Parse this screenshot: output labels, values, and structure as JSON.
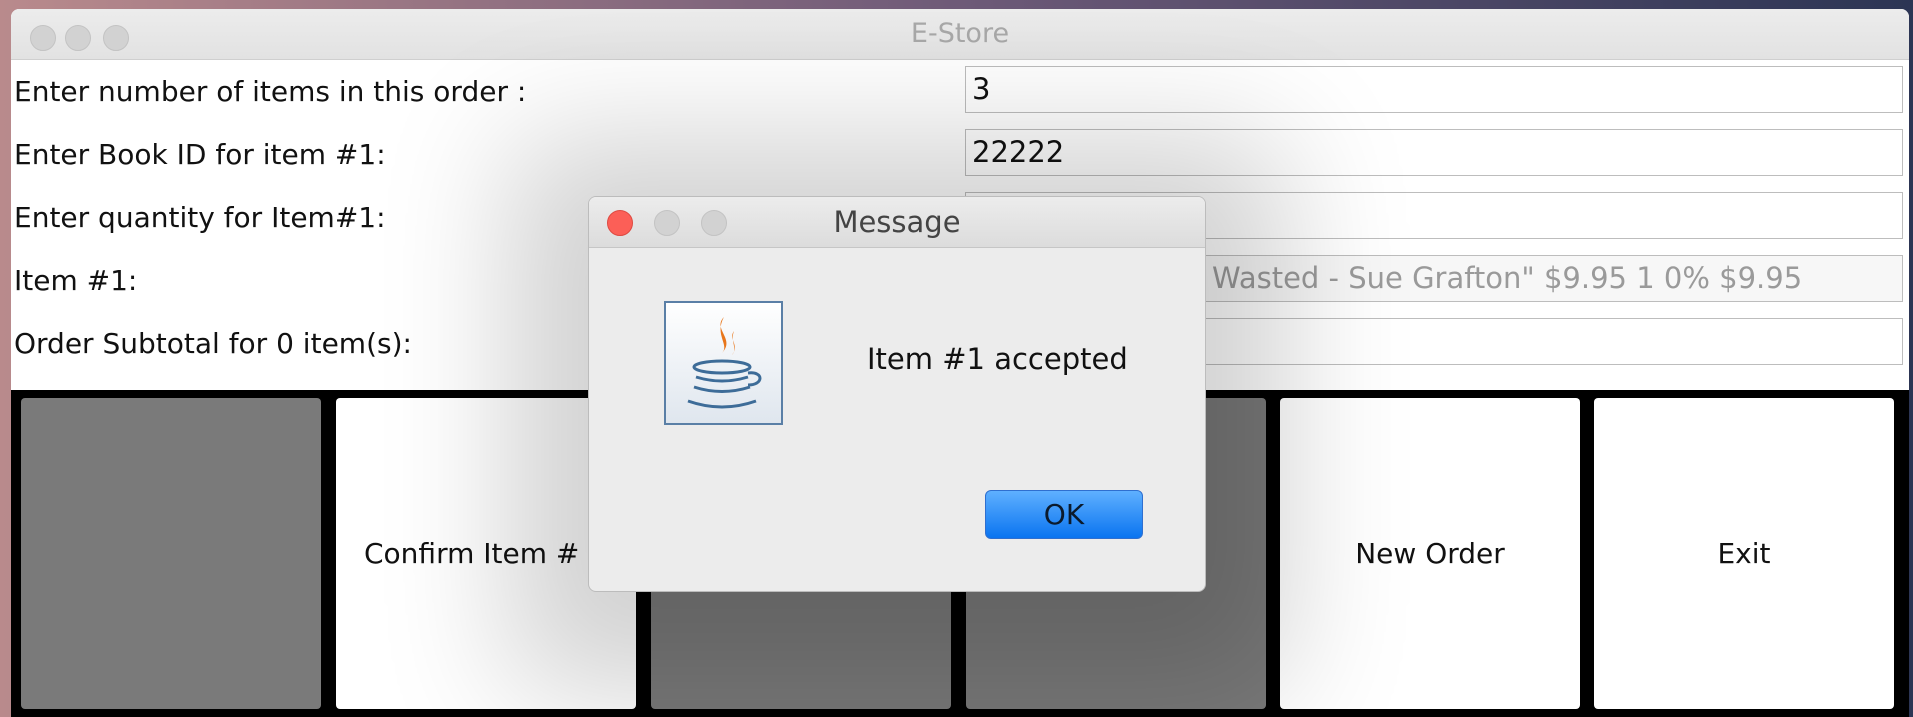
{
  "window": {
    "title": "E-Store"
  },
  "form": {
    "rows": [
      {
        "label": "Enter number of items in this order :",
        "value": "3"
      },
      {
        "label": "Enter Book ID for item #1:",
        "value": "22222"
      },
      {
        "label": "Enter quantity for Item#1:",
        "value": ""
      },
      {
        "label": "Item #1:",
        "value": "Wasted - Sue Grafton\" $9.95 1 0%  $9.95"
      },
      {
        "label": "Order Subtotal for 0 item(s):",
        "value": ""
      }
    ]
  },
  "buttons": {
    "process": "",
    "confirm": "Confirm Item #",
    "view": "",
    "finish": "",
    "new_order": "New Order",
    "exit": "Exit"
  },
  "dialog": {
    "title": "Message",
    "message": "Item #1 accepted",
    "ok_label": "OK",
    "icon": "java-coffee-icon"
  }
}
